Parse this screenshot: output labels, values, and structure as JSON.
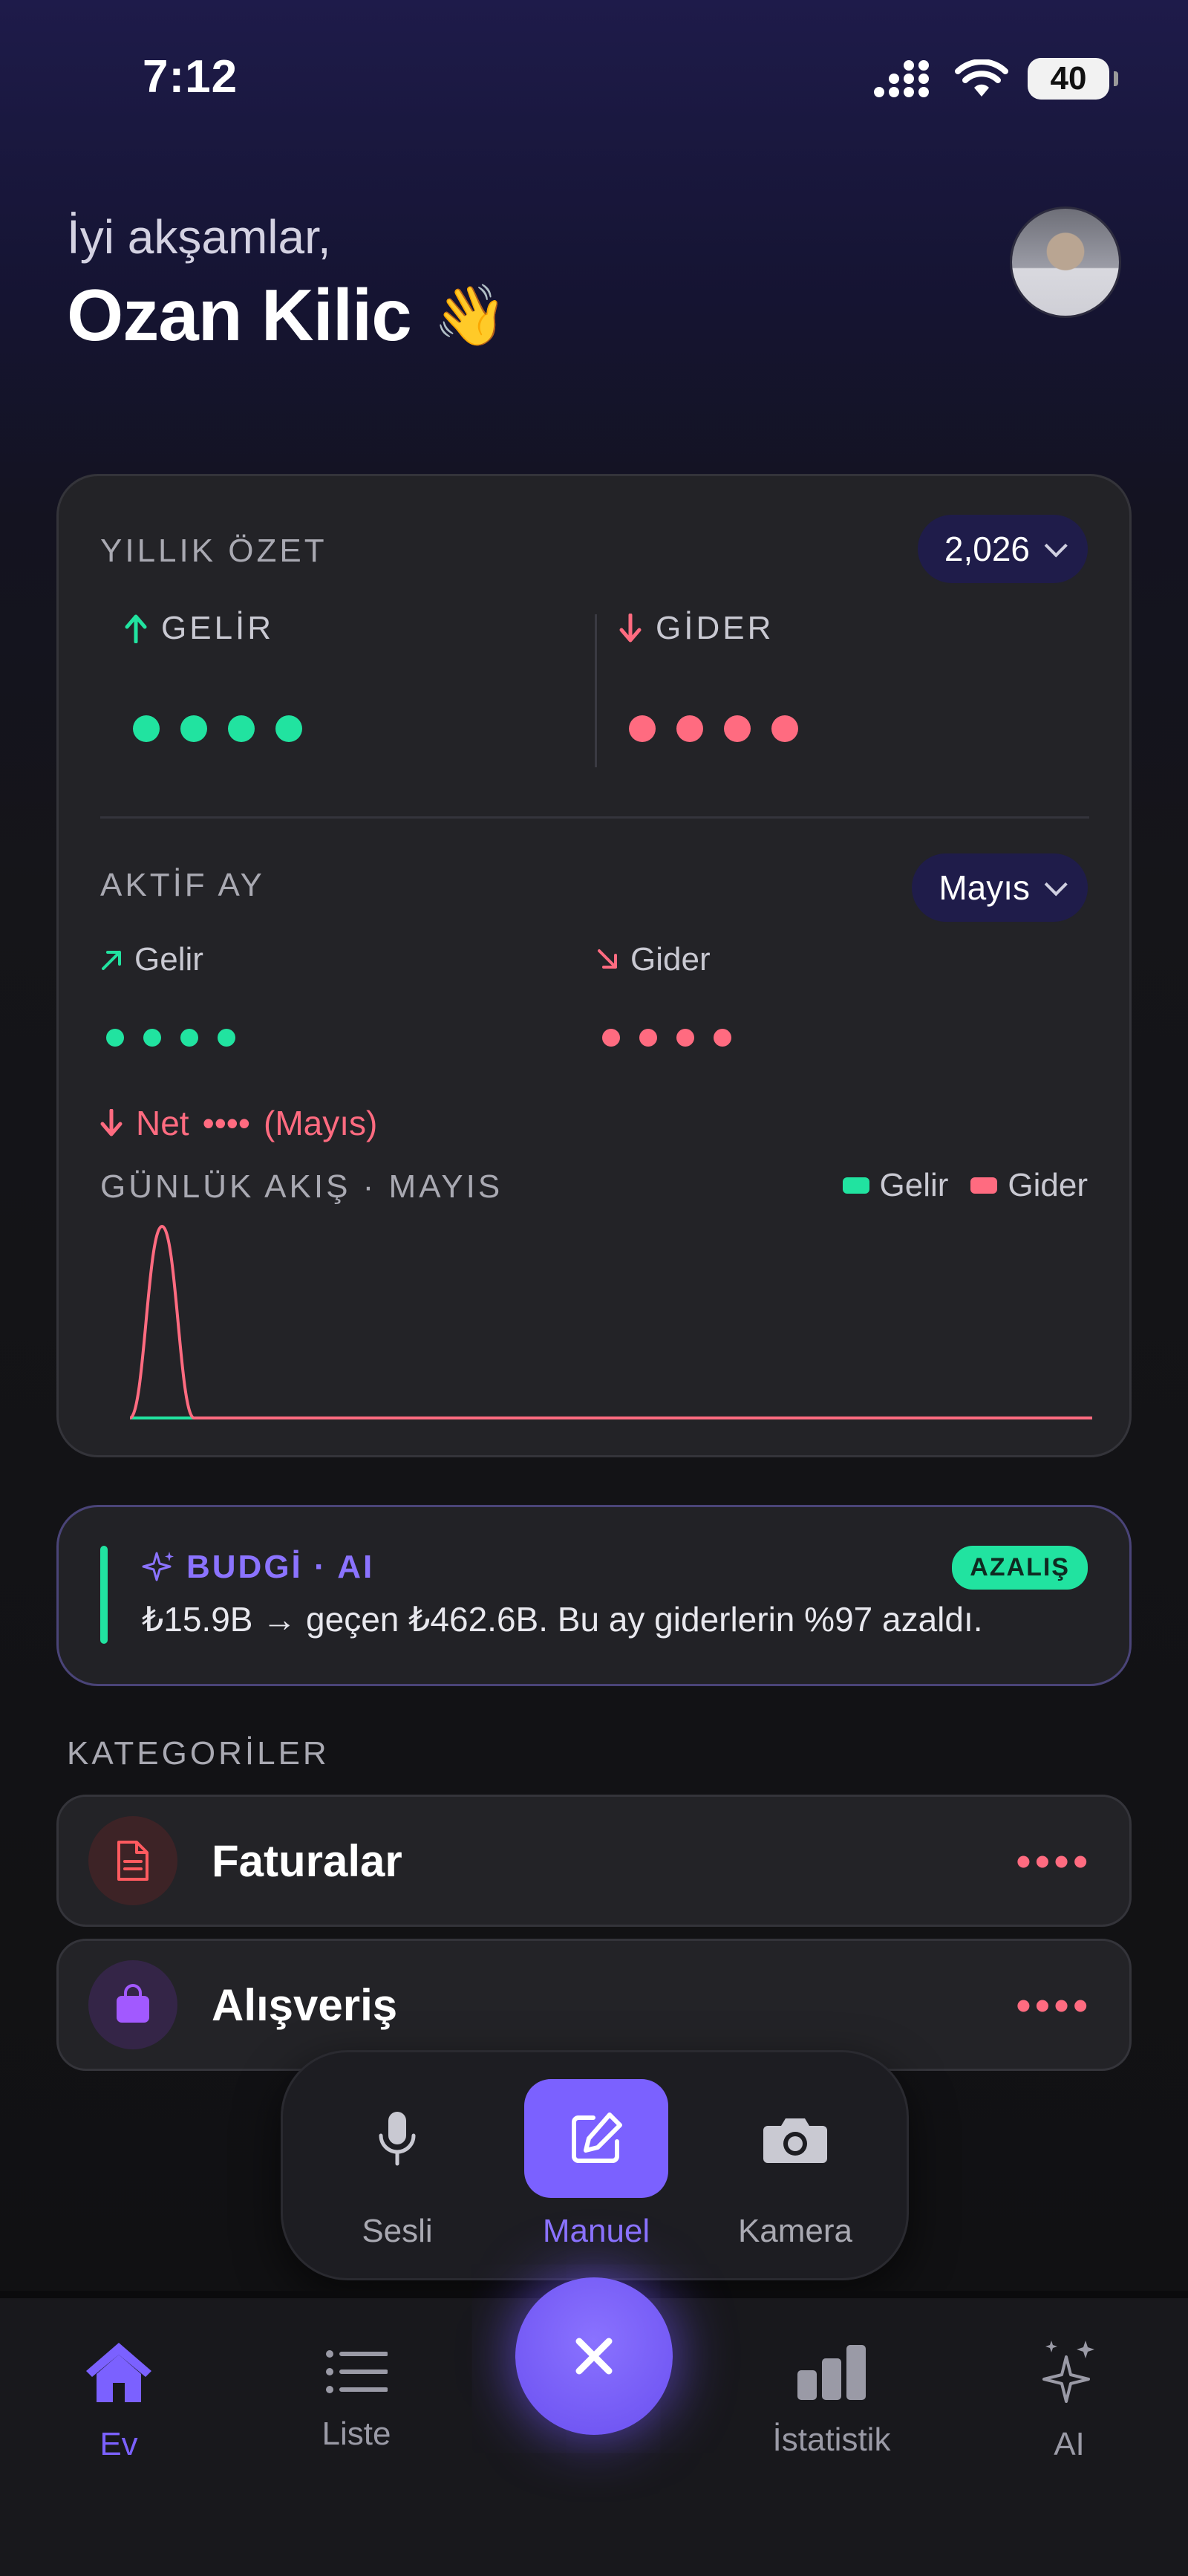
{
  "status_bar": {
    "time": "7:12",
    "battery": "40"
  },
  "greeting": {
    "subtitle": "İyi akşamlar,",
    "name": "Ozan Kilic",
    "emoji": "👋"
  },
  "annual_summary": {
    "title": "YILLIK ÖZET",
    "year": "2,026",
    "income_label": "GELİR",
    "expense_label": "GİDER",
    "income_masked": "••••",
    "expense_masked": "••••"
  },
  "active_month": {
    "title": "AKTİF AY",
    "month": "Mayıs",
    "income_label": "Gelir",
    "expense_label": "Gider",
    "income_masked": "••••",
    "expense_masked": "••••",
    "net_prefix": "Net",
    "net_masked": "••••",
    "net_suffix": "(Mayıs)"
  },
  "daily_flow": {
    "title": "GÜNLÜK AKIŞ · MAYIS",
    "legend": [
      "Gelir",
      "Gider"
    ]
  },
  "chart_data": {
    "type": "area",
    "title": "GÜNLÜK AKIŞ · MAYIS",
    "x": [
      1,
      2,
      3,
      4,
      5,
      6,
      7,
      8,
      9,
      10,
      11,
      12,
      13,
      14,
      15,
      16,
      17,
      18,
      19,
      20,
      21,
      22,
      23,
      24,
      25,
      26,
      27,
      28,
      29,
      30,
      31
    ],
    "series": [
      {
        "name": "Gelir",
        "color": "#21e3a0",
        "values": [
          0,
          0,
          0,
          0,
          0,
          0,
          0,
          0,
          0,
          0,
          0,
          0,
          0,
          0,
          0,
          0,
          0,
          0,
          0,
          0,
          0,
          0,
          0,
          0,
          0,
          0,
          0,
          0,
          0,
          0,
          0
        ]
      },
      {
        "name": "Gider",
        "color": "#ff6b80",
        "values": [
          0,
          1,
          0,
          0,
          0,
          0,
          0,
          0,
          0,
          0,
          0,
          0,
          0,
          0,
          0,
          0,
          0,
          0,
          0,
          0,
          0,
          0,
          0,
          0,
          0,
          0,
          0,
          0,
          0,
          0,
          0
        ]
      }
    ],
    "grid": false,
    "legend": "top-right"
  },
  "insight": {
    "title": "BUDGİ · AI",
    "badge": "AZALIŞ",
    "text": "₺15.9B → geçen ₺462.6B. Bu ay giderlerin %97 azaldı."
  },
  "categories": {
    "title": "KATEGORİLER",
    "items": [
      {
        "name": "Faturalar",
        "amount_masked": "••••",
        "icon": "document-icon",
        "color": "#ff5a5f"
      },
      {
        "name": "Alışveriş",
        "amount_masked": "••••",
        "icon": "shopping-bag-icon",
        "color": "#a259ff"
      }
    ]
  },
  "quick_add": {
    "items": [
      {
        "label": "Sesli",
        "icon": "microphone-icon"
      },
      {
        "label": "Manuel",
        "icon": "edit-icon",
        "active": true
      },
      {
        "label": "Kamera",
        "icon": "camera-icon"
      }
    ]
  },
  "bottom_nav": {
    "items": [
      {
        "label": "Ev",
        "icon": "home-icon",
        "active": true
      },
      {
        "label": "Liste",
        "icon": "list-icon"
      },
      {
        "label": "İstatistik",
        "icon": "bar-chart-icon"
      },
      {
        "label": "AI",
        "icon": "sparkles-icon"
      }
    ]
  },
  "colors": {
    "accent": "#7b61ff",
    "income": "#21e3a0",
    "expense": "#ff6b80"
  }
}
